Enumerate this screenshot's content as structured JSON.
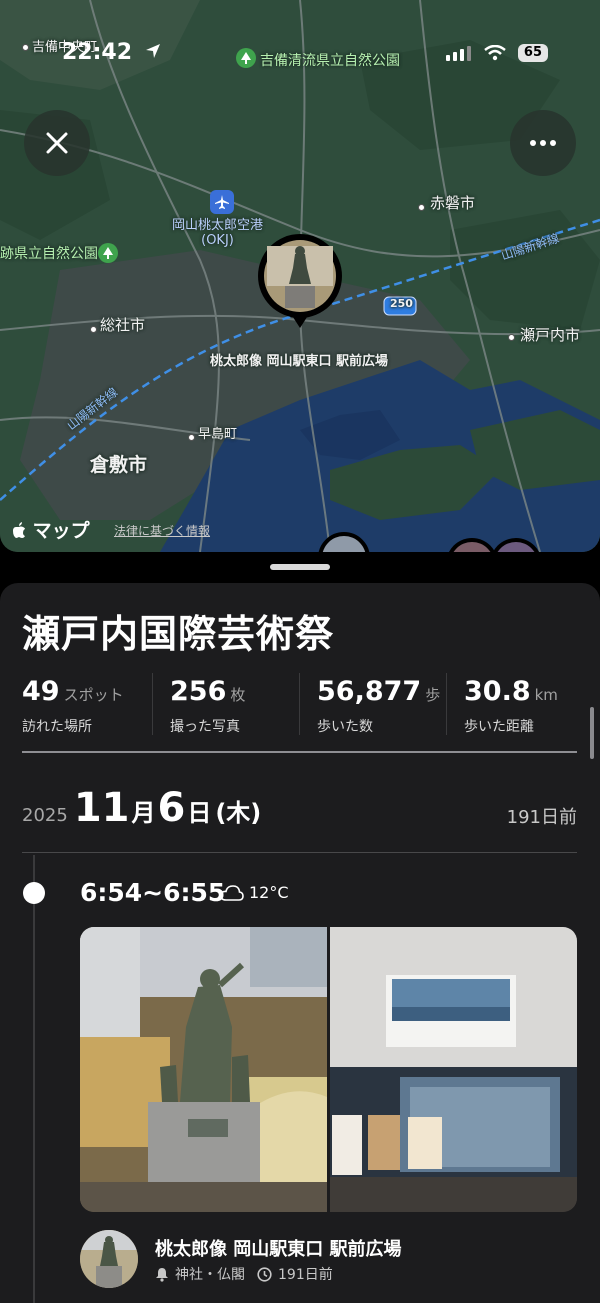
{
  "status_bar": {
    "time": "22:42",
    "battery": "65"
  },
  "map": {
    "labels": {
      "kibi_town": "吉備中央町",
      "kibi_park": "吉備清流県立自然公園",
      "akaiwa": "赤磐市",
      "airport_line1": "岡山桃太郎空港",
      "airport_line2": "(OKJ)",
      "left_park": "跡県立自然公園",
      "shinkansen_right": "山陽新幹線",
      "shinkansen_left": "山陽新幹線",
      "route": "250",
      "soja": "総社市",
      "setouchi": "瀬戸内市",
      "hayashima": "早島町",
      "kurashiki": "倉敷市",
      "pin_place": "桃太郎像 岡山駅東口 駅前広場"
    },
    "maps_logo": "マップ",
    "legal": "法律に基づく情報"
  },
  "trip": {
    "title": "瀬戸内国際芸術祭",
    "stats": [
      {
        "value": "49",
        "unit": "スポット",
        "label": "訪れた場所"
      },
      {
        "value": "256",
        "unit": "枚",
        "label": "撮った写真"
      },
      {
        "value": "56,877",
        "unit": "歩",
        "label": "歩いた数"
      },
      {
        "value": "30.8",
        "unit": "km",
        "label": "歩いた距離"
      }
    ]
  },
  "day": {
    "year": "2025",
    "month": "11",
    "month_suffix": "月",
    "day": "6",
    "day_suffix": "日",
    "weekday": "(木)",
    "ago": "191日前"
  },
  "entry": {
    "time": "6:54~6:55",
    "temperature": "12°C",
    "spot_name": "桃太郎像 岡山駅東口 駅前広場",
    "category": "神社・仏閣",
    "ago": "191日前"
  },
  "colors": {
    "sheet_bg": "#1c1c1e",
    "map_land": "#2d4a3a",
    "map_water": "#1e3c68"
  }
}
